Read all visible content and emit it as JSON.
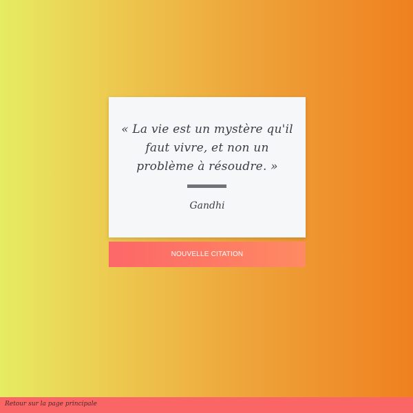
{
  "quote": {
    "text": "« La vie est un mystère qu'il faut vivre, et non un problème à résoudre. »",
    "author": "Gandhi"
  },
  "actions": {
    "new_quote_label": "NOUVELLE CITATION"
  },
  "footer": {
    "back_link_label": "Retour sur la page principale"
  },
  "colors": {
    "background_gradient_start": "#e6ec62",
    "background_gradient_end": "#ef8020",
    "card_background": "#f6f7f9",
    "button_gradient_start": "#fd6768",
    "button_gradient_end": "#fe8a62",
    "footer_background": "#fa6566",
    "text": "#3a3d44"
  }
}
